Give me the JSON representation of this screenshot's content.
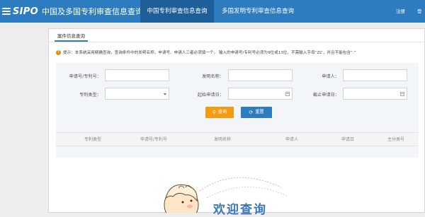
{
  "header": {
    "logo": "SIPO",
    "site_title": "中国及多国专利审查信息查询",
    "tabs": [
      {
        "label": "中国专利审查信息查询",
        "active": true
      },
      {
        "label": "多国发明专利审查信息查询",
        "active": false
      }
    ],
    "links": [
      "注册",
      "登"
    ]
  },
  "panel": {
    "tab_label": "案件信息查询",
    "tip": "提示：本系统采用精确查询，查询条件中的发明名称，申请号、申请人三者必须填一个。 输入的申请号/专利号必须为9位或13位，不需输入字母“ZL”，并且不能包含“.”"
  },
  "form": {
    "application_number_label": "申请号/专利号：",
    "invention_name_label": "发明名称：",
    "applicant_label": "申请人：",
    "patent_type_label": "专利类型：",
    "start_date_label": "起始申请日：",
    "end_date_label": "截止申请日：",
    "application_number_value": "",
    "invention_name_value": "",
    "applicant_value": "",
    "patent_type_selected": "",
    "start_date_value": "",
    "end_date_value": "",
    "query_button": "查询",
    "reset_button": "重置"
  },
  "table": {
    "columns": [
      "专利类型",
      "申请号/专利号",
      "发明名称",
      "申请人",
      "申请日",
      "主分类号"
    ]
  },
  "welcome": {
    "text": "欢迎查询"
  },
  "colors": {
    "brand_blue": "#2d7cc0",
    "active_tab": "#1e5f99",
    "query_orange": "#f39c12",
    "tip_orange": "#f08a00"
  }
}
